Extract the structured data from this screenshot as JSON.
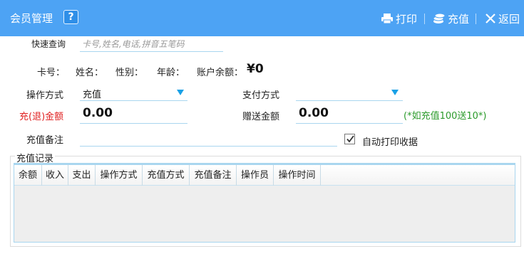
{
  "window": {
    "title": "会员管理",
    "help_symbol": "?",
    "print_label": "打印",
    "recharge_label": "充值",
    "back_label": "返回"
  },
  "icons": [
    "help-icon",
    "printer-icon",
    "coins-icon",
    "close-icon",
    "dropdown-arrow-icon",
    "checkmark-icon"
  ],
  "colors": {
    "titlebar": "#4da3f4",
    "accent": "#1aa1e6",
    "red_label": "#e02020",
    "hint": "#2a9a2a"
  },
  "search": {
    "label": "快速查询",
    "placeholder": "卡号,姓名,电话,拼音五笔码"
  },
  "member": {
    "card_label": "卡号：",
    "name_label": "姓名：",
    "gender_label": "性别：",
    "age_label": "年龄：",
    "balance_label": "账户余额：",
    "balance_value": "¥0"
  },
  "form": {
    "op_label": "操作方式",
    "op_value": "充值",
    "pay_label": "支付方式",
    "pay_value": "",
    "amount_label": "充(退)金额",
    "amount_value": "0.00",
    "bonus_label": "赠送金额",
    "bonus_value": "0.00",
    "bonus_hint": "(*如充值100送10*)",
    "note_label": "充值备注",
    "note_value": "",
    "auto_print_label": "自动打印收据",
    "auto_print_checked": true
  },
  "records": {
    "title": "充值记录",
    "columns": [
      "余额",
      "收入",
      "支出",
      "操作方式",
      "充值方式",
      "充值备注",
      "操作员",
      "操作时间"
    ],
    "rows": []
  }
}
